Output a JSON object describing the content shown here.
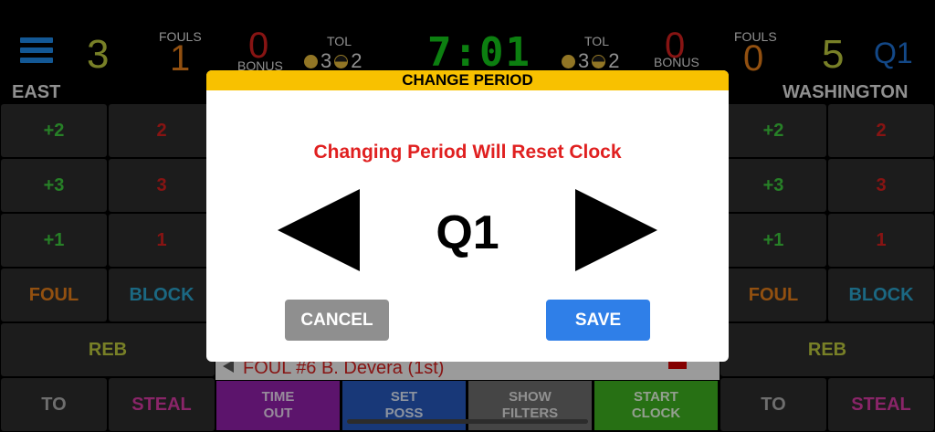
{
  "header": {
    "left": {
      "score": "3",
      "fouls_label": "FOULS",
      "fouls": "1",
      "bonus_value": "0",
      "bonus_label": "BONUS",
      "tol_label": "TOL",
      "tol_full": "3",
      "tol_half": "2",
      "team": "EAST"
    },
    "clock": "7:01",
    "right": {
      "score": "5",
      "fouls_label": "FOULS",
      "fouls": "0",
      "bonus_value": "0",
      "bonus_label": "BONUS",
      "tol_label": "TOL",
      "tol_full": "3",
      "tol_half": "2",
      "team": "WASHINGTON"
    },
    "period": "Q1"
  },
  "left_grid": {
    "plus2": "+2",
    "miss2": "2",
    "plus3": "+3",
    "miss3": "3",
    "plus1": "+1",
    "miss1": "1",
    "foul": "FOUL",
    "block": "BLOCK",
    "reb": "REB",
    "to": "TO",
    "steal": "STEAL"
  },
  "right_grid": {
    "plus2": "+2",
    "miss2": "2",
    "plus3": "+3",
    "miss3": "3",
    "plus1": "+1",
    "miss1": "1",
    "foul": "FOUL",
    "block": "BLOCK",
    "reb": "REB",
    "to": "TO",
    "steal": "STEAL"
  },
  "log": {
    "last_event": "FOUL #6 B. Devera (1st)"
  },
  "actions": {
    "timeout": "TIME\nOUT",
    "set_poss": "SET\nPOSS",
    "show_filters": "SHOW\nFILTERS",
    "start_clock": "START\nCLOCK"
  },
  "modal": {
    "title": "CHANGE PERIOD",
    "warning": "Changing Period Will Reset Clock",
    "period": "Q1",
    "cancel": "CANCEL",
    "save": "SAVE"
  },
  "colors": {
    "modal_header": "#f8c100",
    "save": "#2f7fe8",
    "cancel": "#8f8f8f",
    "warning": "#e02020",
    "clock": "#13c41a"
  },
  "icons": [
    "menu-icon",
    "timeout-full-dot-icon",
    "timeout-half-dot-icon",
    "prev-period-arrow-icon",
    "next-period-arrow-icon"
  ]
}
